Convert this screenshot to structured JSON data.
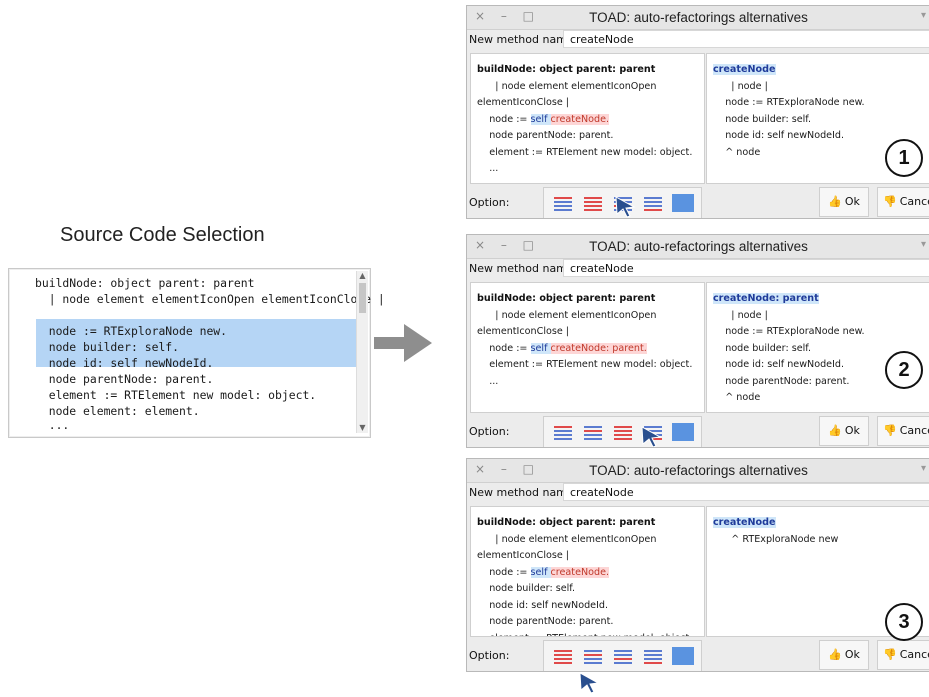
{
  "source": {
    "heading": "Source Code Selection",
    "lines": [
      {
        "text": "buildNode: object parent: parent"
      },
      {
        "text": "  | node element elementIconOpen elementIconClose |"
      },
      {
        "text": ""
      },
      {
        "text": "  node := RTExploraNode new."
      },
      {
        "text": "  node builder: self."
      },
      {
        "text": "  node id: self newNodeId."
      },
      {
        "text": "  node parentNode: parent."
      },
      {
        "text": "  element := RTElement new model: object."
      },
      {
        "text": "  node element: element."
      },
      {
        "text": "  ..."
      }
    ]
  },
  "windows": [
    {
      "title": "TOAD: auto-refactorings alternatives",
      "method_label": "New method name:",
      "method_value": "createNode",
      "left_code": [
        "buildNode: object parent: parent",
        "      | node element elementIconOpen",
        "elementIconClose |",
        "    node := self createNode.",
        "    node parentNode: parent.",
        "    element := RTElement new model: object.",
        "    ..."
      ],
      "right_code": [
        "createNode",
        "      | node |",
        "    node := RTExploraNode new.",
        "    node builder: self.",
        "    node id: self newNodeId.",
        "    ^ node"
      ],
      "option_label": "Option:",
      "ok_label": "Ok",
      "cancel_label": "Cancel",
      "number": "1"
    },
    {
      "title": "TOAD: auto-refactorings alternatives",
      "method_label": "New method name:",
      "method_value": "createNode",
      "left_code": [
        "buildNode: object parent: parent",
        "      | node element elementIconOpen",
        "elementIconClose |",
        "    node := self createNode: parent.",
        "    element := RTElement new model: object.",
        "    ..."
      ],
      "right_code": [
        "createNode: parent",
        "      | node |",
        "    node := RTExploraNode new.",
        "    node builder: self.",
        "    node id: self newNodeId.",
        "    node parentNode: parent.",
        "    ^ node"
      ],
      "option_label": "Option:",
      "ok_label": "Ok",
      "cancel_label": "Cancel",
      "number": "2"
    },
    {
      "title": "TOAD: auto-refactorings alternatives",
      "method_label": "New method name:",
      "method_value": "createNode",
      "left_code": [
        "buildNode: object parent: parent",
        "      | node element elementIconOpen",
        "elementIconClose |",
        "    node := self createNode.",
        "    node builder: self.",
        "    node id: self newNodeId.",
        "    node parentNode: parent.",
        "    element := RTElement new model: object.",
        "    ..."
      ],
      "right_code": [
        "createNode",
        "      ^ RTExploraNode new"
      ],
      "option_label": "Option:",
      "ok_label": "Ok",
      "cancel_label": "Cancel",
      "number": "3"
    }
  ],
  "icons": {
    "ok": "thumbs-up-icon",
    "cancel": "thumbs-down-icon",
    "arrow": "right-arrow-icon",
    "cursor": "mouse-pointer-icon"
  },
  "colors": {
    "selection": "#b5d5f5",
    "extracted_call": "#fdd6d6",
    "ok_green": "#4a9b2a",
    "cancel_red": "#c0392b",
    "option_blue": "#5a93e0"
  }
}
